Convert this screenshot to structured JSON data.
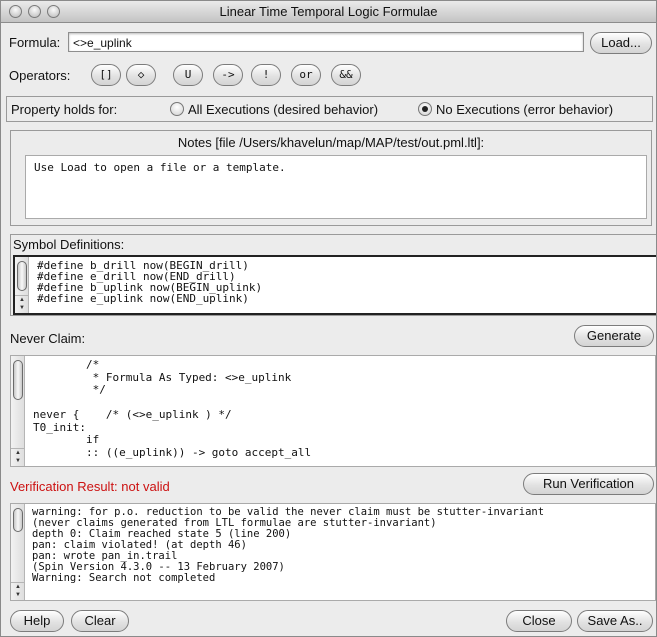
{
  "window": {
    "title": "Linear Time Temporal Logic Formulae"
  },
  "formula": {
    "label": "Formula:",
    "value": "<>e_uplink",
    "load_label": "Load..."
  },
  "operators": {
    "label": "Operators:",
    "items": [
      "[]",
      "<>",
      "U",
      "->",
      "!",
      "or",
      "&&"
    ],
    "glyphs": [
      "[]",
      "◇",
      "U",
      "->",
      "!",
      "or",
      "&&"
    ]
  },
  "property": {
    "label": "Property holds for:",
    "options": [
      {
        "label": "All Executions (desired behavior)",
        "selected": false
      },
      {
        "label": "No Executions (error behavior)",
        "selected": true
      }
    ]
  },
  "notes": {
    "title": "Notes [file /Users/khavelun/map/MAP/test/out.pml.ltl]:",
    "text": "Use Load to open a file or a template."
  },
  "symbols": {
    "title": "Symbol Definitions:",
    "lines": [
      "#define b_drill now(BEGIN_drill)",
      "#define e_drill now(END_drill)",
      "#define b_uplink now(BEGIN_uplink)",
      "#define e_uplink now(END_uplink)"
    ]
  },
  "never_claim": {
    "title": "Never Claim:",
    "generate_label": "Generate",
    "lines": [
      "        /*",
      "         * Formula As Typed: <>e_uplink",
      "         */",
      "",
      "never {    /* (<>e_uplink ) */",
      "T0_init:",
      "        if",
      "        :: ((e_uplink)) -> goto accept_all"
    ]
  },
  "verification": {
    "result_label": "Verification Result: not valid",
    "run_label": "Run Verification",
    "result_color": "#cc1111",
    "lines": [
      "warning: for p.o. reduction to be valid the never claim must be stutter-invariant",
      "(never claims generated from LTL formulae are stutter-invariant)",
      "depth 0: Claim reached state 5 (line 200)",
      "pan: claim violated! (at depth 46)",
      "pan: wrote pan_in.trail",
      "(Spin Version 4.3.0 -- 13 February 2007)",
      "Warning: Search not completed"
    ]
  },
  "footer": {
    "help_label": "Help",
    "clear_label": "Clear",
    "close_label": "Close",
    "save_label": "Save As.."
  }
}
